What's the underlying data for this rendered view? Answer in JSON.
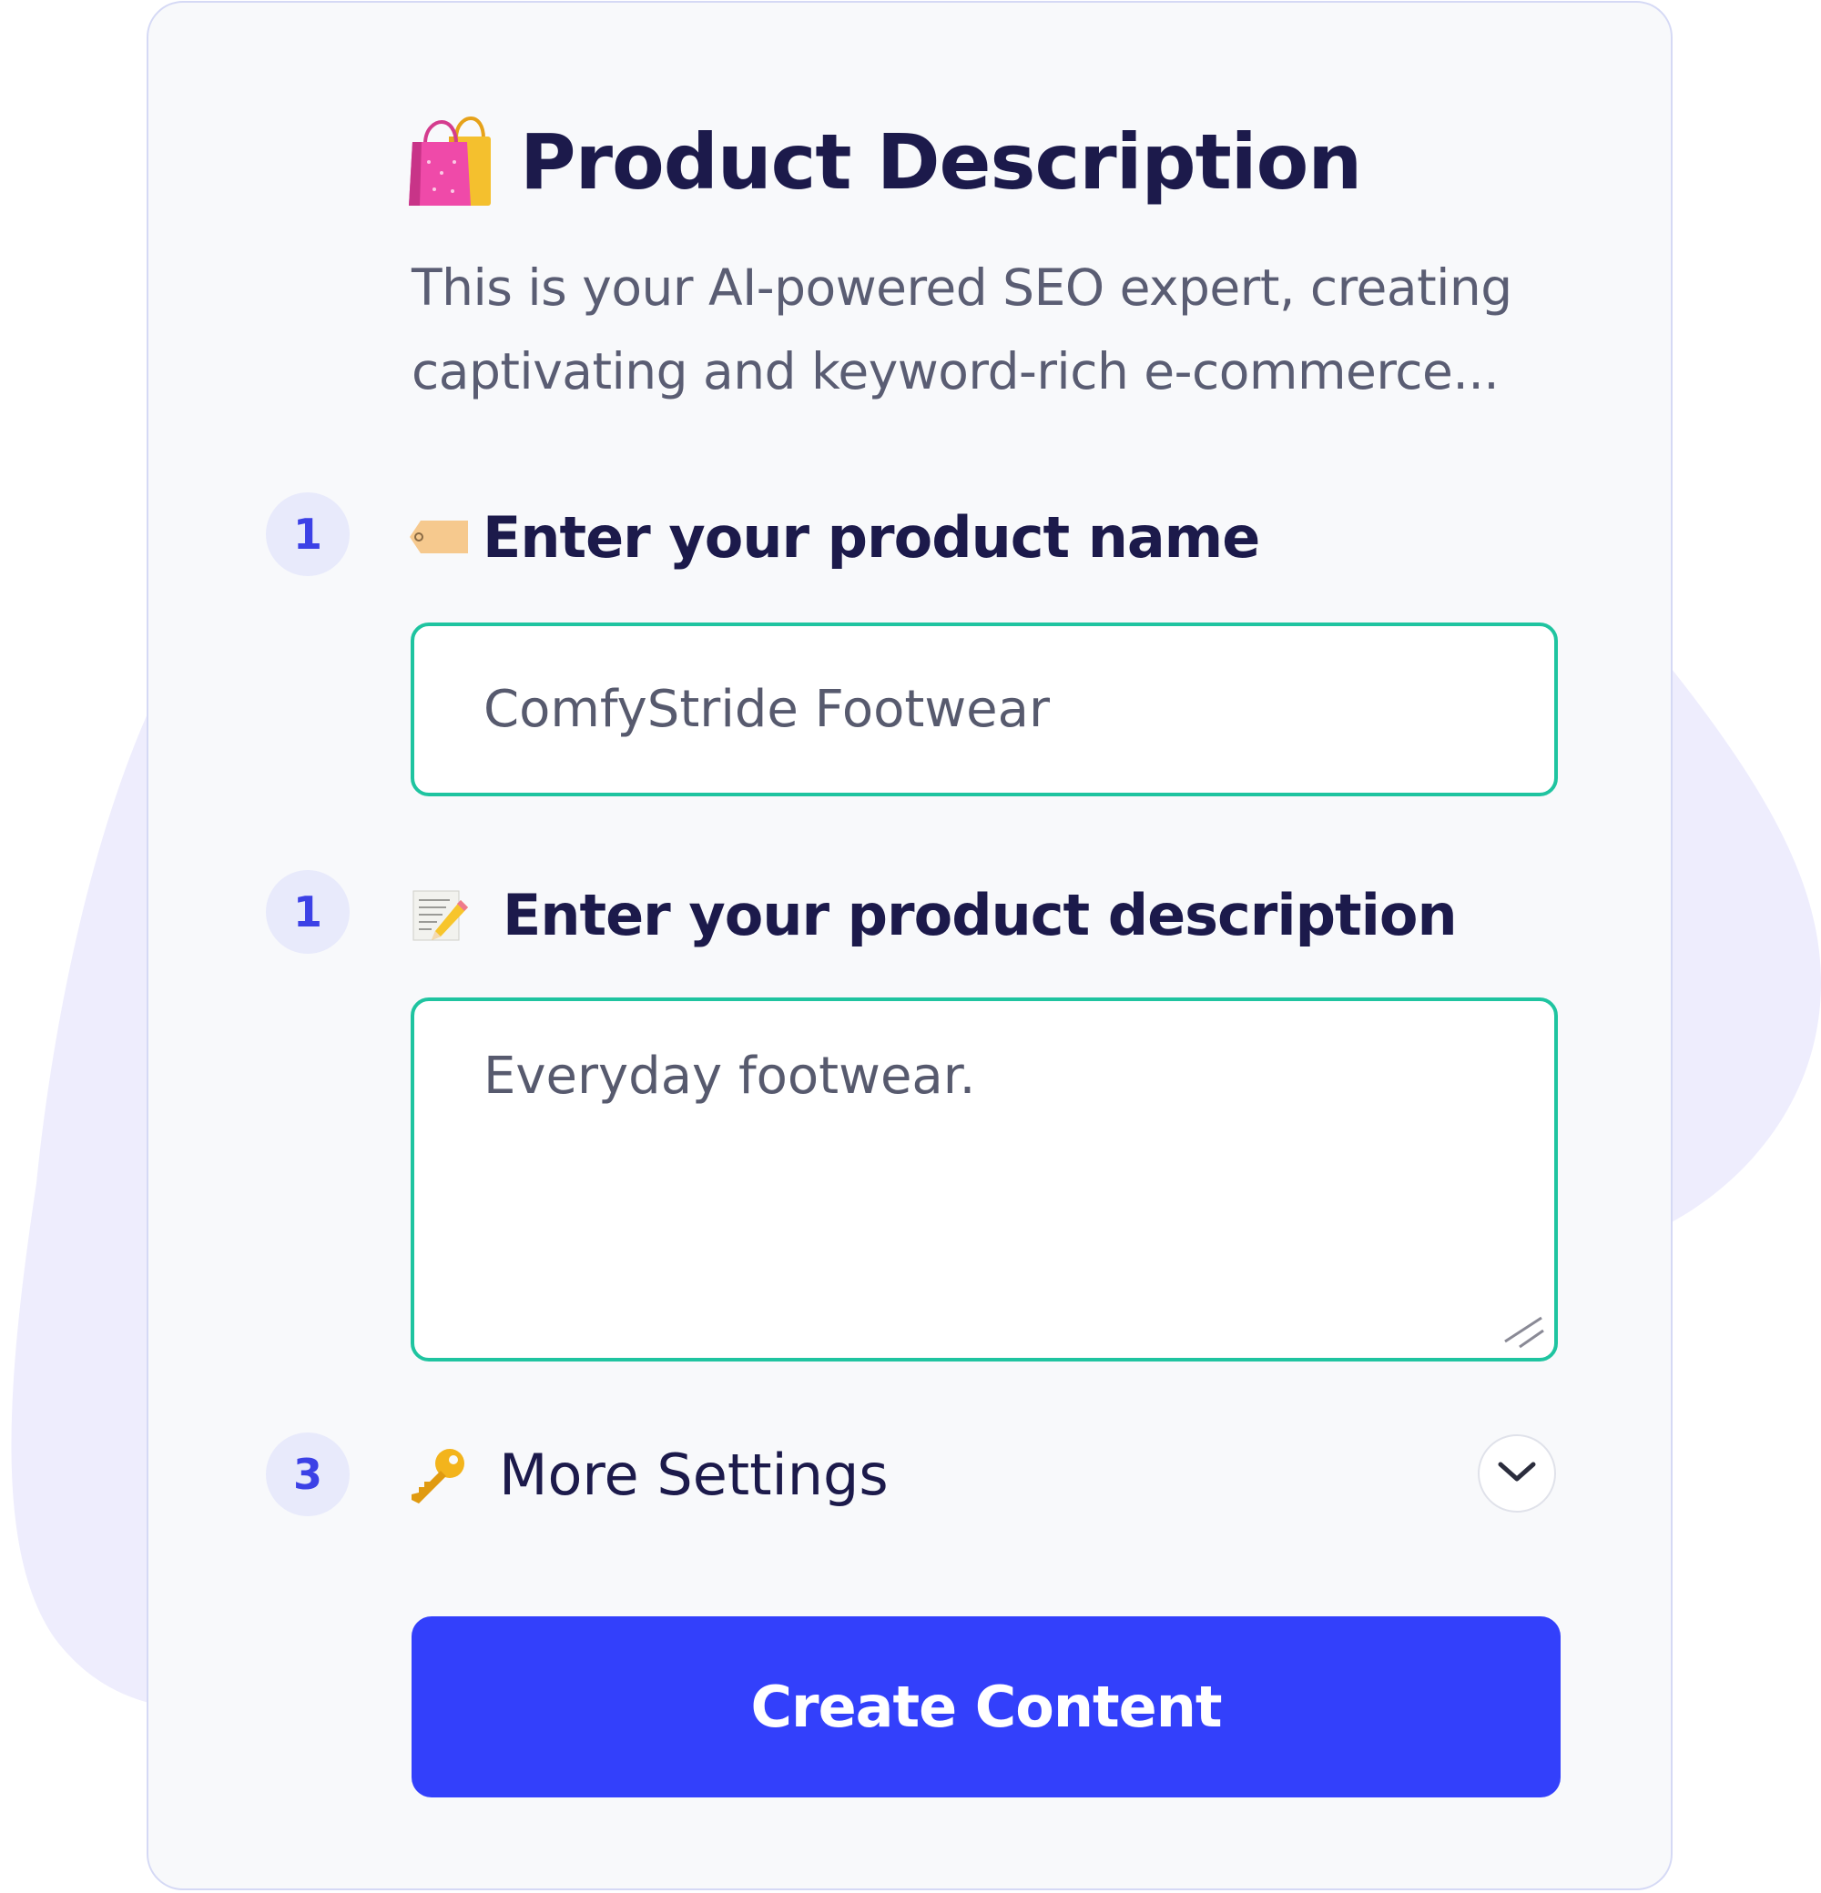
{
  "header": {
    "title": "Product Description",
    "subtitle": "This is your AI-powered SEO expert, creating captivating and keyword-rich e-commerce...",
    "icon": "shopping-bags-icon"
  },
  "steps": [
    {
      "number": "1",
      "label": "Enter your product name",
      "icon": "price-tag-icon",
      "value": "ComfyStride Footwear"
    },
    {
      "number": "1",
      "label": "Enter your product description",
      "icon": "memo-pencil-icon",
      "value": "Everyday footwear."
    },
    {
      "number": "3",
      "label": "More Settings",
      "icon": "key-icon",
      "toggle_icon": "chevron-down-icon"
    }
  ],
  "actions": {
    "create_label": "Create Content"
  },
  "colors": {
    "accent": "#3340fb",
    "field_border": "#1fc4a0",
    "step_badge_bg": "#e8eafb",
    "step_badge_text": "#3c41e6",
    "heading": "#1c1a4b",
    "background_blob": "#eeedfd"
  }
}
